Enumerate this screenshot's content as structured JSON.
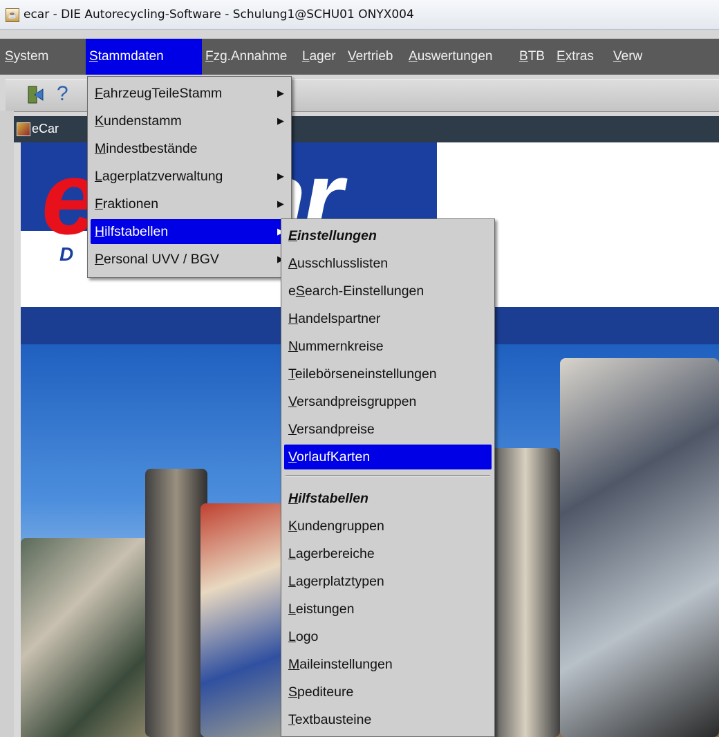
{
  "window": {
    "title": "ecar - DIE Autorecycling-Software - Schulung1@SCHU01   ONYX004"
  },
  "menubar": {
    "items": [
      {
        "u": "S",
        "rest": "ystem"
      },
      {
        "u": "S",
        "rest": "tammdaten"
      },
      {
        "u": "F",
        "rest": "zg.Annahme"
      },
      {
        "u": "L",
        "rest": "ager"
      },
      {
        "u": "V",
        "rest": "ertrieb"
      },
      {
        "u": "A",
        "rest": "uswertungen"
      },
      {
        "u": "B",
        "rest": "TB"
      },
      {
        "u": "E",
        "rest": "xtras"
      },
      {
        "u": "V",
        "rest": "erw"
      }
    ]
  },
  "toolbar": {
    "exit_icon": "exit-icon",
    "help_glyph": "?"
  },
  "inner_window": {
    "title": "eCar"
  },
  "logo": {
    "e": "e",
    "rest": "ar",
    "d": "D"
  },
  "stammdaten_menu": {
    "items": [
      {
        "u": "F",
        "rest": "ahrzeugTeileStamm",
        "submenu": true
      },
      {
        "u": "K",
        "rest": "undenstamm",
        "submenu": true
      },
      {
        "u": "M",
        "rest": "indestbestände",
        "submenu": false
      },
      {
        "u": "L",
        "rest": "agerplatzverwaltung",
        "submenu": true
      },
      {
        "u": "F",
        "rest": "raktionen",
        "submenu": true
      },
      {
        "u": "H",
        "rest": "ilfstabellen",
        "submenu": true
      },
      {
        "u": "P",
        "rest": "ersonal UVV / BGV",
        "submenu": true
      }
    ],
    "arrow": "▶"
  },
  "hilfstabellen_menu": {
    "einstellungen_header": {
      "u": "E",
      "rest": "instellungen"
    },
    "einstellungen_items": [
      {
        "pre": "",
        "u": "A",
        "rest": "usschlusslisten"
      },
      {
        "pre": "e",
        "u": "S",
        "rest": "earch-Einstellungen"
      },
      {
        "pre": "",
        "u": "H",
        "rest": "andelspartner"
      },
      {
        "pre": "",
        "u": "N",
        "rest": "ummernkreise"
      },
      {
        "pre": "",
        "u": "T",
        "rest": "eilebörseneinstellungen"
      },
      {
        "pre": "",
        "u": "V",
        "rest": "ersandpreisgruppen"
      },
      {
        "pre": "",
        "u": "V",
        "rest": "ersandpreise"
      },
      {
        "pre": "",
        "u": "V",
        "rest": "orlaufKarten"
      }
    ],
    "hilfstabellen_header": {
      "u": "H",
      "rest": "ilfstabellen"
    },
    "hilfstabellen_items": [
      {
        "pre": "",
        "u": "K",
        "rest": "undengruppen"
      },
      {
        "pre": "",
        "u": "L",
        "rest": "agerbereiche"
      },
      {
        "pre": "",
        "u": "L",
        "rest": "agerplatztypen"
      },
      {
        "pre": "",
        "u": "L",
        "rest": "eistungen"
      },
      {
        "pre": "",
        "u": "L",
        "rest": "ogo"
      },
      {
        "pre": "",
        "u": "M",
        "rest": "aileinstellungen"
      },
      {
        "pre": "",
        "u": "S",
        "rest": "pediteure"
      },
      {
        "pre": "",
        "u": "T",
        "rest": "extbausteine"
      }
    ]
  },
  "colors": {
    "selection": "#0000e6",
    "menubar": "#5a5a5a",
    "menu_bg": "#cfcfcf",
    "logo_blue": "#1a3fa0",
    "logo_red": "#e8101a"
  }
}
